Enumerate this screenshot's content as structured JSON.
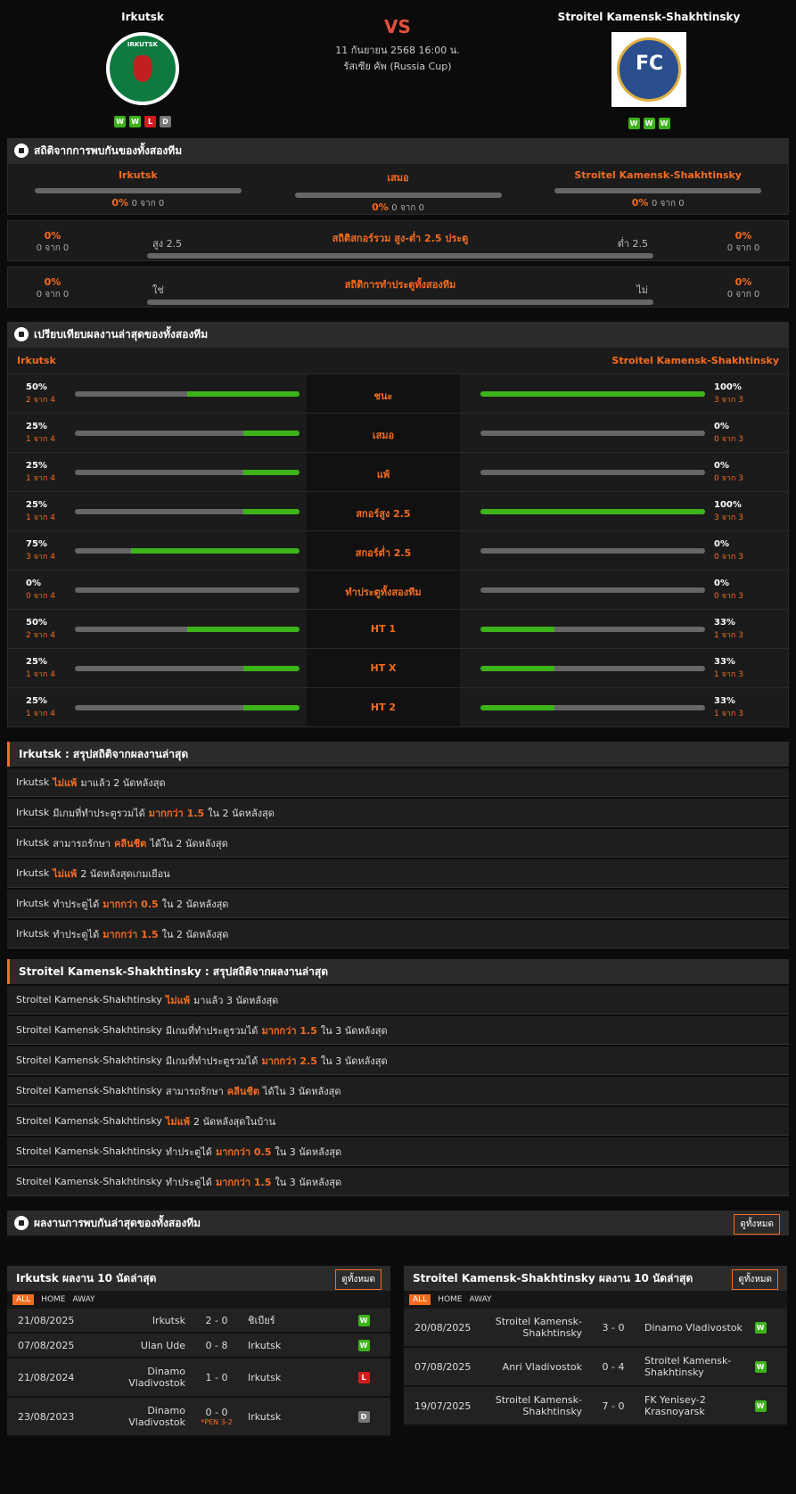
{
  "match": {
    "home": "Irkutsk",
    "away": "Stroitel Kamensk-Shakhtinsky",
    "vs": "VS",
    "date": "11 กันยายน 2568 16:00 น.",
    "competition": "รัสเซีย คัพ (Russia Cup)",
    "home_form": [
      "W",
      "W",
      "L",
      "D"
    ],
    "away_form": [
      "W",
      "W",
      "W"
    ],
    "home_logo_text": "IRKUTSK",
    "away_logo_text": "FC"
  },
  "h2h": {
    "title": "สถิติจากการพบกันของทั้งสองทีม",
    "home": "Irkutsk",
    "draw": "เสมอ",
    "away": "Stroitel Kamensk-Shakhtinsky",
    "home_pct": "0%",
    "home_sub": "0 จาก 0",
    "draw_pct": "0%",
    "draw_sub": "0 จาก 0",
    "away_pct": "0%",
    "away_sub": "0 จาก 0"
  },
  "ou": {
    "title": "สถิติสกอร์รวม สูง-ต่ำ 2.5 ประตู",
    "left": "สูง 2.5",
    "right": "ต่ำ 2.5",
    "lpct": "0%",
    "lsub": "0 จาก 0",
    "rpct": "0%",
    "rsub": "0 จาก 0"
  },
  "btts": {
    "title": "สถิติการทำประตูทั้งสองทีม",
    "left": "ใช่",
    "right": "ไม่",
    "lpct": "0%",
    "lsub": "0 จาก 0",
    "rpct": "0%",
    "rsub": "0 จาก 0"
  },
  "compare": {
    "title": "เปรียบเทียบผลงานล่าสุดของทั้งสองทีม",
    "home": "Irkutsk",
    "away": "Stroitel Kamensk-Shakhtinsky",
    "rows": [
      {
        "label": "ชนะ",
        "hp": "50%",
        "hs": "2 จาก 4",
        "hv": 0.5,
        "ap": "100%",
        "as": "3 จาก 3",
        "av": 1
      },
      {
        "label": "เสมอ",
        "hp": "25%",
        "hs": "1 จาก 4",
        "hv": 0.25,
        "ap": "0%",
        "as": "0 จาก 3",
        "av": 0
      },
      {
        "label": "แพ้",
        "hp": "25%",
        "hs": "1 จาก 4",
        "hv": 0.25,
        "ap": "0%",
        "as": "0 จาก 3",
        "av": 0
      },
      {
        "label": "สกอร์สูง 2.5",
        "hp": "25%",
        "hs": "1 จาก 4",
        "hv": 0.25,
        "ap": "100%",
        "as": "3 จาก 3",
        "av": 1
      },
      {
        "label": "สกอร์ต่ำ 2.5",
        "hp": "75%",
        "hs": "3 จาก 4",
        "hv": 0.75,
        "ap": "0%",
        "as": "0 จาก 3",
        "av": 0
      },
      {
        "label": "ทำประตูทั้งสองทีม",
        "hp": "0%",
        "hs": "0 จาก 4",
        "hv": 0,
        "ap": "0%",
        "as": "0 จาก 3",
        "av": 0
      },
      {
        "label": "HT 1",
        "hp": "50%",
        "hs": "2 จาก 4",
        "hv": 0.5,
        "ap": "33%",
        "as": "1 จาก 3",
        "av": 0.33
      },
      {
        "label": "HT X",
        "hp": "25%",
        "hs": "1 จาก 4",
        "hv": 0.25,
        "ap": "33%",
        "as": "1 จาก 3",
        "av": 0.33
      },
      {
        "label": "HT 2",
        "hp": "25%",
        "hs": "1 จาก 4",
        "hv": 0.25,
        "ap": "33%",
        "as": "1 จาก 3",
        "av": 0.33
      }
    ]
  },
  "home_summary": {
    "title": "Irkutsk : สรุปสถิติจากผลงานล่าสุด",
    "rows": [
      [
        "Irkutsk",
        "ไม่แพ้",
        "มาแล้ว 2 นัดหลังสุด"
      ],
      [
        "Irkutsk",
        "มีเกมที่ทำประตูรวมได้",
        "มากกว่า 1.5",
        "ใน 2 นัดหลังสุด"
      ],
      [
        "Irkutsk",
        "สามารถรักษา",
        "คลีนชีต",
        "ได้ใน 2 นัดหลังสุด"
      ],
      [
        "Irkutsk",
        "ไม่แพ้",
        "2 นัดหลังสุดเกมเยือน"
      ],
      [
        "Irkutsk",
        "ทำประตูได้",
        "มากกว่า 0.5",
        "ใน 2 นัดหลังสุด"
      ],
      [
        "Irkutsk",
        "ทำประตูได้",
        "มากกว่า 1.5",
        "ใน 2 นัดหลังสุด"
      ]
    ]
  },
  "away_summary": {
    "title": "Stroitel Kamensk-Shakhtinsky : สรุปสถิติจากผลงานล่าสุด",
    "rows": [
      [
        "Stroitel Kamensk-Shakhtinsky",
        "ไม่แพ้",
        "มาแล้ว 3 นัดหลังสุด"
      ],
      [
        "Stroitel Kamensk-Shakhtinsky",
        "มีเกมที่ทำประตูรวมได้",
        "มากกว่า 1.5",
        "ใน 3 นัดหลังสุด"
      ],
      [
        "Stroitel Kamensk-Shakhtinsky",
        "มีเกมที่ทำประตูรวมได้",
        "มากกว่า 2.5",
        "ใน 3 นัดหลังสุด"
      ],
      [
        "Stroitel Kamensk-Shakhtinsky",
        "สามารถรักษา",
        "คลีนชีต",
        "ได้ใน 3 นัดหลังสุด"
      ],
      [
        "Stroitel Kamensk-Shakhtinsky",
        "ไม่แพ้",
        "2 นัดหลังสุดในบ้าน"
      ],
      [
        "Stroitel Kamensk-Shakhtinsky",
        "ทำประตูได้",
        "มากกว่า 0.5",
        "ใน 3 นัดหลังสุด"
      ],
      [
        "Stroitel Kamensk-Shakhtinsky",
        "ทำประตูได้",
        "มากกว่า 1.5",
        "ใน 3 นัดหลังสุด"
      ]
    ]
  },
  "recent_h2h": {
    "title": "ผลงานการพบกันล่าสุดของทั้งสองทีม",
    "btn": "ดูทั้งหมด"
  },
  "home_last": {
    "title": "Irkutsk ผลงาน 10 นัดล่าสุด",
    "btn": "ดูทั้งหมด",
    "tabs": [
      "ALL",
      "HOME",
      "AWAY"
    ],
    "rows": [
      {
        "date": "21/08/2025",
        "home": "Irkutsk",
        "score": "2 - 0",
        "away": "ชิเบียร์",
        "res": "W",
        "pen": ""
      },
      {
        "date": "07/08/2025",
        "home": "Ulan Ude",
        "score": "0 - 8",
        "away": "Irkutsk",
        "res": "W",
        "pen": ""
      },
      {
        "date": "21/08/2024",
        "home": "Dinamo Vladivostok",
        "score": "1 - 0",
        "away": "Irkutsk",
        "res": "L",
        "pen": ""
      },
      {
        "date": "23/08/2023",
        "home": "Dinamo Vladivostok",
        "score": "0 - 0",
        "away": "Irkutsk",
        "res": "D",
        "pen": "*PEN 3-2"
      }
    ]
  },
  "away_last": {
    "title": "Stroitel Kamensk-Shakhtinsky ผลงาน 10 นัดล่าสุด",
    "btn": "ดูทั้งหมด",
    "tabs": [
      "ALL",
      "HOME",
      "AWAY"
    ],
    "rows": [
      {
        "date": "20/08/2025",
        "home": "Stroitel Kamensk-Shakhtinsky",
        "score": "3 - 0",
        "away": "Dinamo Vladivostok",
        "res": "W",
        "pen": ""
      },
      {
        "date": "07/08/2025",
        "home": "Anri Vladivostok",
        "score": "0 - 4",
        "away": "Stroitel Kamensk-Shakhtinsky",
        "res": "W",
        "pen": ""
      },
      {
        "date": "19/07/2025",
        "home": "Stroitel Kamensk-Shakhtinsky",
        "score": "7 - 0",
        "away": "FK Yenisey-2 Krasnoyarsk",
        "res": "W",
        "pen": ""
      }
    ]
  }
}
